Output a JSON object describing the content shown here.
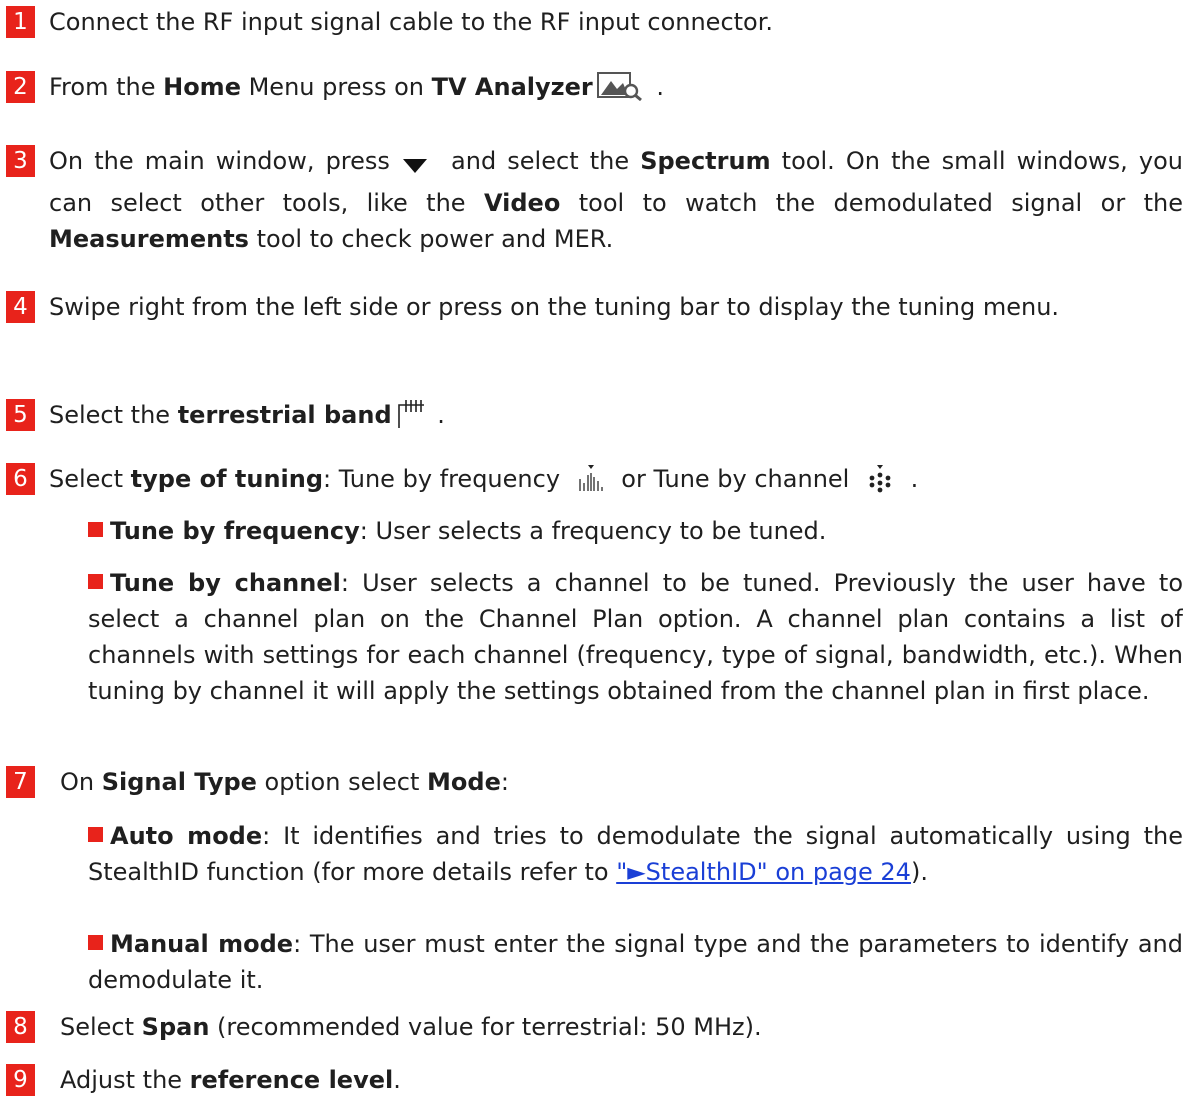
{
  "steps": [
    {
      "num": "1",
      "text": "Connect the RF input signal cable to the RF input connector."
    },
    {
      "num": "2",
      "t1": "From the ",
      "b1": "Home",
      "t2": " Menu press on ",
      "b2": "TV Analyzer",
      "t3": " ."
    },
    {
      "num": "3",
      "t1": "On the main window, press",
      "t2": " and select the ",
      "b1": "Spectrum",
      "t3": " tool. On the small windows, you can select other tools, like the ",
      "b2": "Video",
      "t4": " tool to watch the demodulated signal or the ",
      "b3": "Measurements",
      "t5": " tool to check power and MER."
    },
    {
      "num": "4",
      "text": "Swipe right from the left side or press on the tuning bar to display the tuning menu."
    },
    {
      "num": "5",
      "t1": "Select the ",
      "b1": "terrestrial band",
      "t2": " ."
    },
    {
      "num": "6",
      "t1": "Select ",
      "b1": "type of tuning",
      "t2": ": Tune by frequency ",
      "t3": " or Tune by channel ",
      "t4": " .",
      "bullets": [
        {
          "b": "Tune by frequency",
          "t": ": User selects a frequency to be tuned."
        },
        {
          "b": "Tune by channel",
          "t": ": User selects a channel to be tuned. Previously the user have to select a channel plan on the Channel Plan option. A channel plan contains a list of channels with settings for each channel (frequency, type of signal, bandwidth, etc.). When tuning by channel it will apply the settings obtained from the channel plan in first place."
        }
      ]
    },
    {
      "num": "7",
      "t1": "On ",
      "b1": "Signal Type",
      "t2": " option select ",
      "b2": "Mode",
      "t3": ":",
      "bullets": [
        {
          "b": "Auto mode",
          "t": ": It identifies and tries to demodulate the signal automatically using the StealthID function (for more details refer to ",
          "link": "\"►StealthID\" on page 24",
          "t2": ")."
        },
        {
          "b": "Manual mode",
          "t": ": The user must enter the signal type and the parameters to identify and demodulate it."
        }
      ]
    },
    {
      "num": "8",
      "t1": "Select ",
      "b1": "Span",
      "t2": " (recommended value for terrestrial: 50 MHz)."
    },
    {
      "num": "9",
      "t1": "Adjust the ",
      "b1": "reference level",
      "t2": "."
    }
  ],
  "icons": {
    "tv_analyzer": "tv-analyzer-icon",
    "dropdown": "dropdown-triangle-icon",
    "terrestrial": "terrestrial-band-icon",
    "tune_frequency": "tune-by-frequency-icon",
    "tune_channel": "tune-by-channel-icon"
  },
  "colors": {
    "accent": "#e8231b",
    "link": "#1a3fd6",
    "text": "#1f1f1f"
  }
}
